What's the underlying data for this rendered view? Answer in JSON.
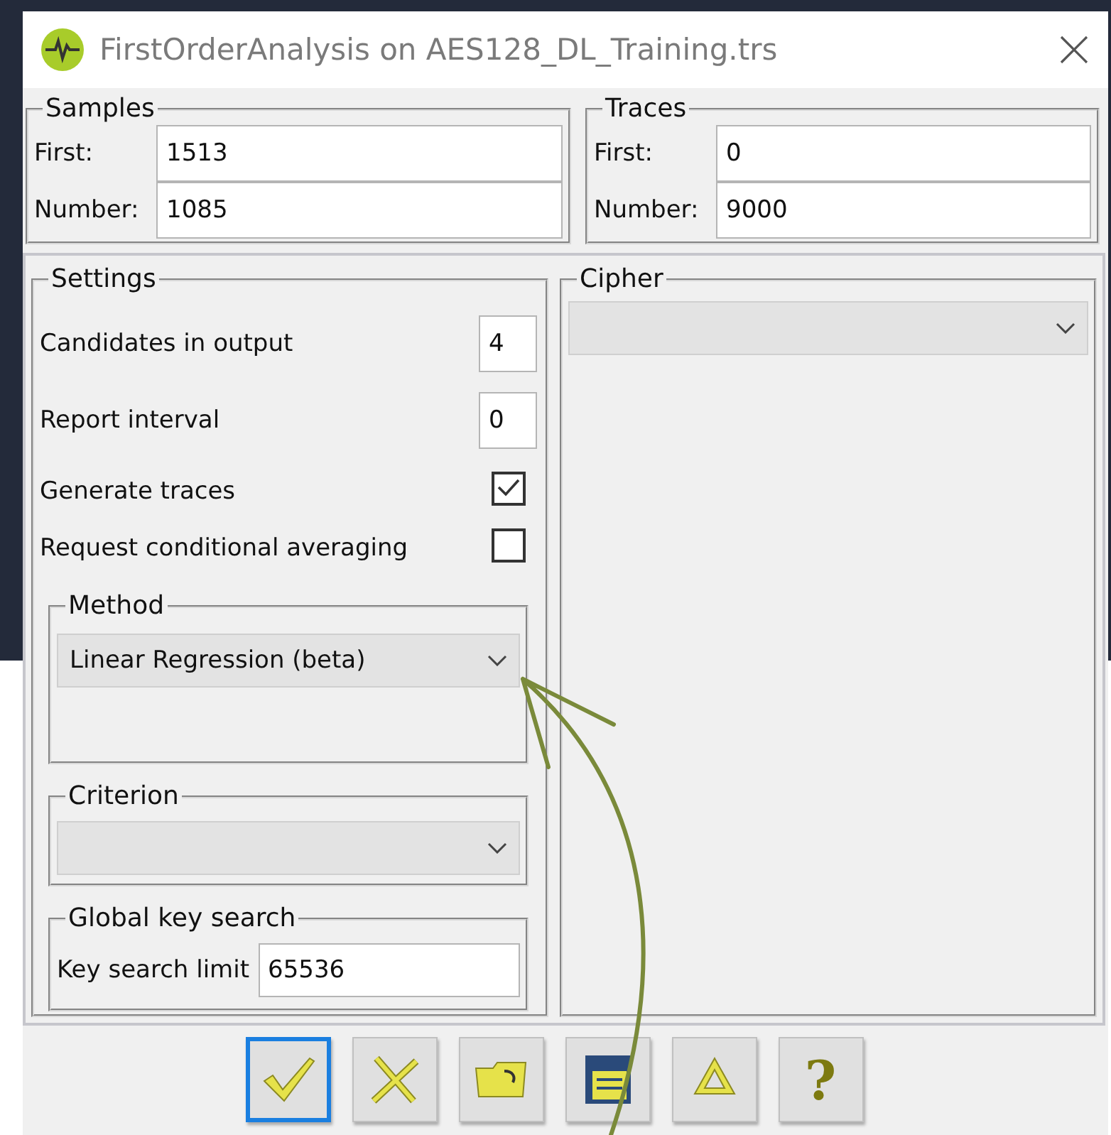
{
  "window": {
    "title": "FirstOrderAnalysis on AES128_DL_Training.trs"
  },
  "samples": {
    "title": "Samples",
    "fields": [
      {
        "label": "First:",
        "value": "1513"
      },
      {
        "label": "Number:",
        "value": "1085"
      }
    ]
  },
  "traces": {
    "title": "Traces",
    "fields": [
      {
        "label": "First:",
        "value": "0"
      },
      {
        "label": "Number:",
        "value": "9000"
      }
    ]
  },
  "settings": {
    "title": "Settings",
    "rows": [
      {
        "kind": "number",
        "label": "Candidates in output",
        "value": "4"
      },
      {
        "kind": "number",
        "label": "Report interval",
        "value": "0"
      },
      {
        "kind": "checkbox",
        "label": "Generate traces",
        "checked": true
      },
      {
        "kind": "checkbox",
        "label": "Request conditional averaging",
        "checked": false
      }
    ],
    "method": {
      "title": "Method",
      "value": "Linear Regression (beta)"
    },
    "criterion": {
      "title": "Criterion"
    },
    "key_search": {
      "title": "Global key search",
      "label": "Key search limit",
      "value": "65536"
    }
  },
  "cipher": {
    "title": "Cipher"
  },
  "toolbar": [
    {
      "kind": "ok",
      "selected": true
    },
    {
      "kind": "cancel",
      "selected": false
    },
    {
      "kind": "open",
      "selected": false
    },
    {
      "kind": "save",
      "selected": false
    },
    {
      "kind": "reset",
      "selected": false
    },
    {
      "kind": "help",
      "label": "?",
      "selected": false
    }
  ]
}
